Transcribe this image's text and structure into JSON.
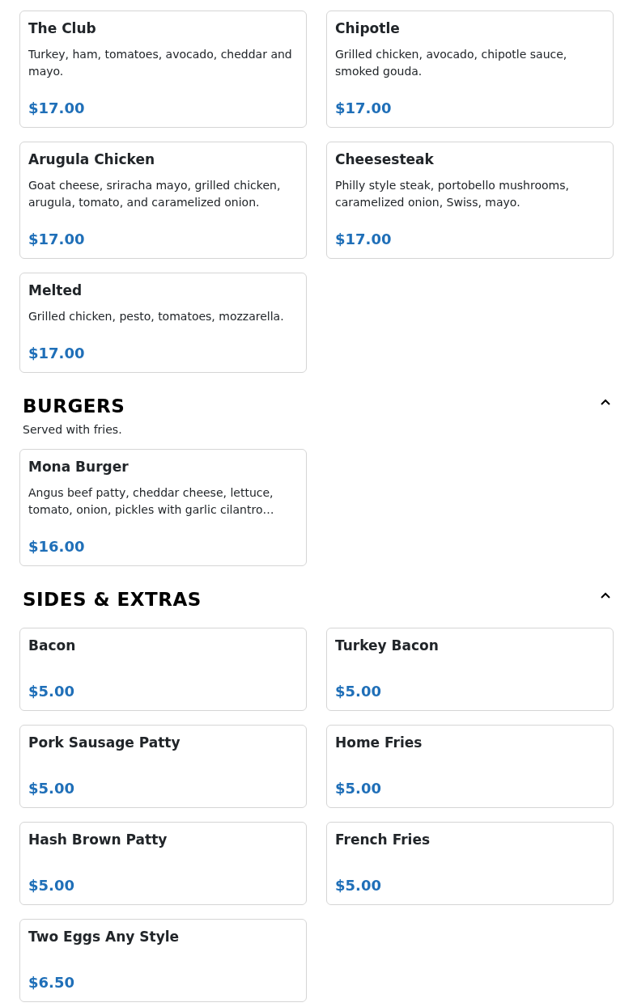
{
  "sections": [
    {
      "items": [
        {
          "name": "The Club",
          "description": "Turkey, ham, tomatoes, avocado, cheddar and mayo.",
          "price": "$17.00"
        },
        {
          "name": "Chipotle",
          "description": "Grilled chicken, avocado, chipotle sauce, smoked gouda.",
          "price": "$17.00"
        },
        {
          "name": "Arugula Chicken",
          "description": "Goat cheese, sriracha mayo, grilled chicken, arugula, tomato, and caramelized onion.",
          "price": "$17.00"
        },
        {
          "name": "Cheesesteak",
          "description": "Philly style steak, portobello mushrooms, caramelized onion, Swiss, mayo.",
          "price": "$17.00"
        },
        {
          "name": "Melted",
          "description": "Grilled chicken, pesto, tomatoes, mozzarella.",
          "price": "$17.00"
        }
      ]
    },
    {
      "title": "BURGERS",
      "subtitle": "Served with fries.",
      "expanded": true,
      "items": [
        {
          "name": "Mona Burger",
          "description": "Angus beef patty, cheddar cheese, lettuce, tomato, onion, pickles with garlic cilantro…",
          "price": "$16.00"
        }
      ]
    },
    {
      "title": "SIDES & EXTRAS",
      "expanded": true,
      "items": [
        {
          "name": "Bacon",
          "price": "$5.00"
        },
        {
          "name": "Turkey Bacon",
          "price": "$5.00"
        },
        {
          "name": "Pork Sausage Patty",
          "price": "$5.00"
        },
        {
          "name": "Home Fries",
          "price": "$5.00"
        },
        {
          "name": "Hash Brown Patty",
          "price": "$5.00"
        },
        {
          "name": "French Fries",
          "price": "$5.00"
        },
        {
          "name": "Two Eggs Any Style",
          "price": "$6.50"
        }
      ]
    }
  ]
}
